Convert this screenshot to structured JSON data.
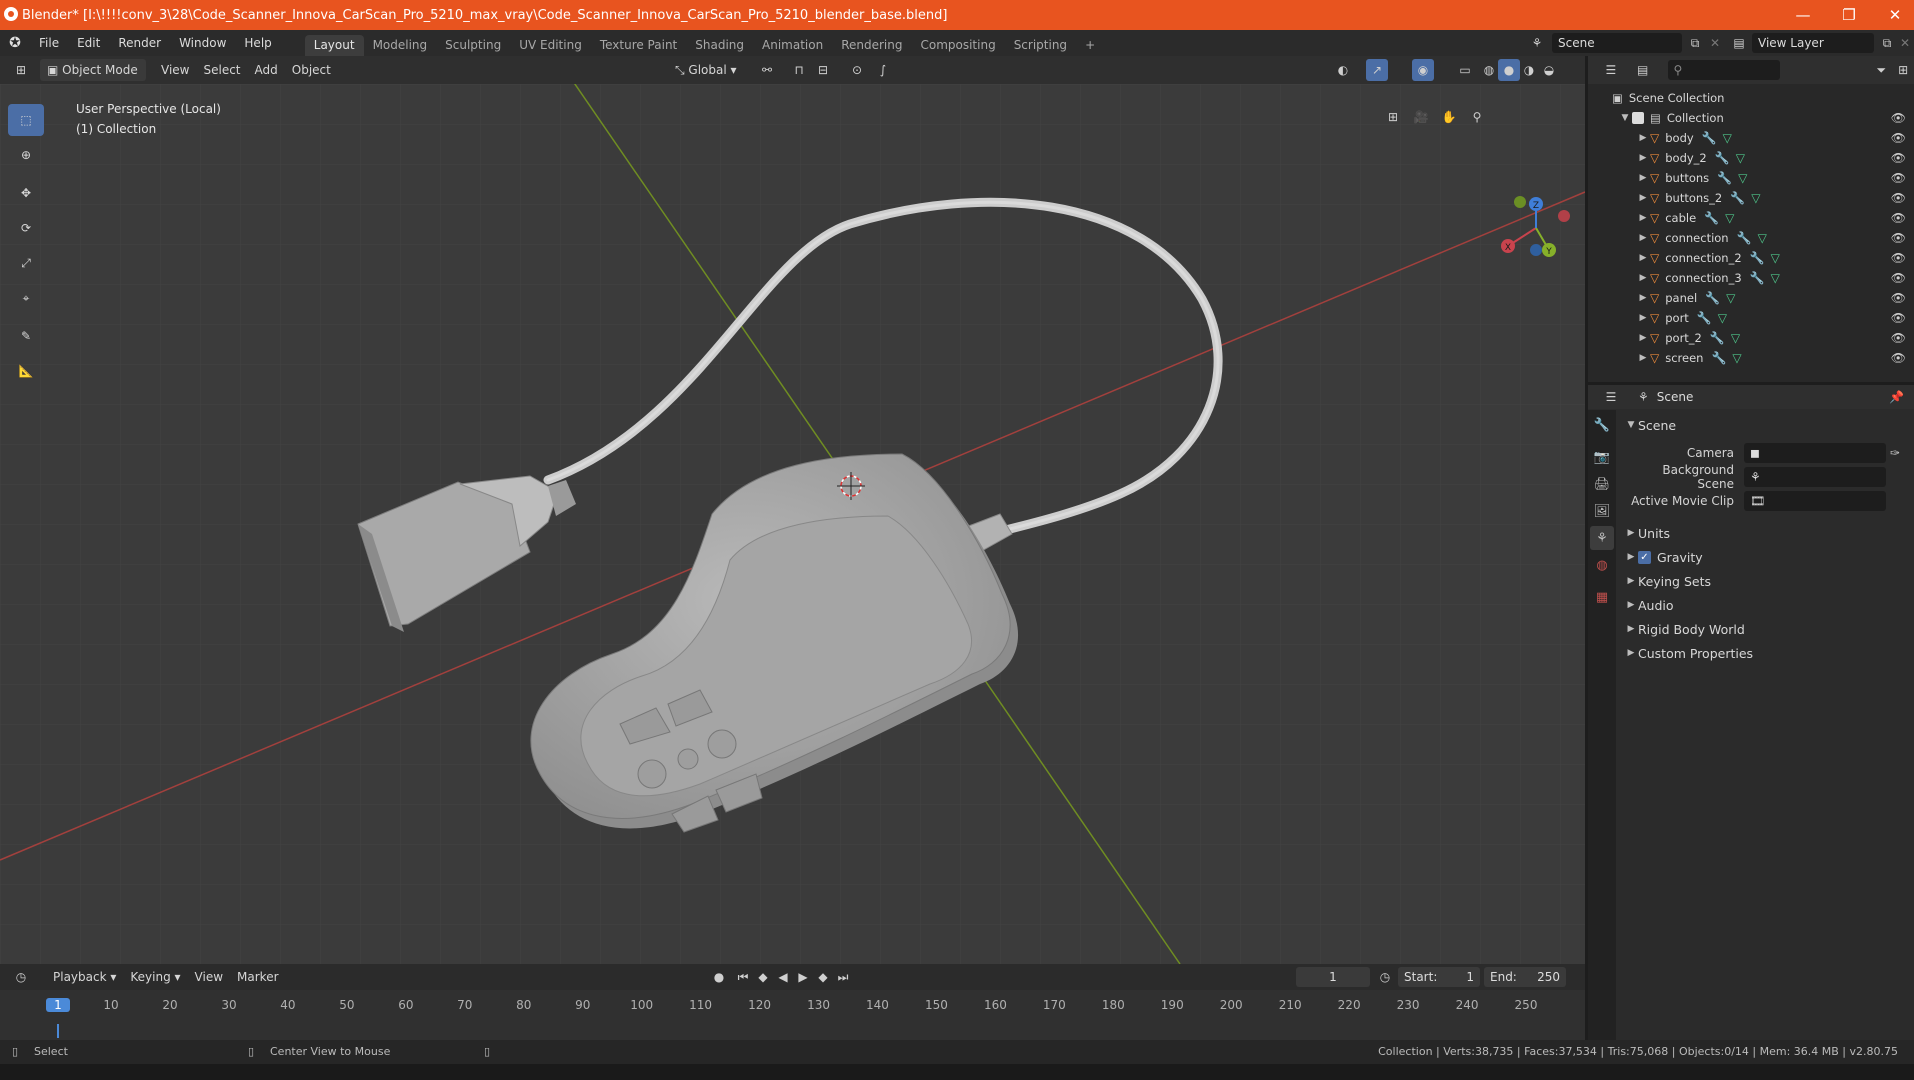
{
  "window": {
    "title": "Blender* [I:\\!!!!conv_3\\28\\Code_Scanner_Innova_CarScan_Pro_5210_max_vray\\Code_Scanner_Innova_CarScan_Pro_5210_blender_base.blend]",
    "minimize": "—",
    "restore": "❐",
    "close": "✕"
  },
  "menu": {
    "items": [
      "File",
      "Edit",
      "Render",
      "Window",
      "Help"
    ],
    "tabs": [
      "Layout",
      "Modeling",
      "Sculpting",
      "UV Editing",
      "Texture Paint",
      "Shading",
      "Animation",
      "Rendering",
      "Compositing",
      "Scripting"
    ],
    "add_tab": "+",
    "scene_label": "Scene",
    "view_layer_label": "View Layer"
  },
  "viewport_header": {
    "mode": "Object Mode",
    "items": [
      "View",
      "Select",
      "Add",
      "Object"
    ],
    "orientation": "Global"
  },
  "viewport": {
    "perspective": "User Perspective (Local)",
    "collection": "(1) Collection",
    "gizmo": {
      "x": "X",
      "y": "Y",
      "z": "Z"
    }
  },
  "outliner": {
    "root": "Scene Collection",
    "collection": "Collection",
    "objects": [
      "body",
      "body_2",
      "buttons",
      "buttons_2",
      "cable",
      "connection",
      "connection_2",
      "connection_3",
      "panel",
      "port",
      "port_2",
      "screen"
    ]
  },
  "properties": {
    "header": "Scene",
    "panel_title": "Scene",
    "camera_label": "Camera",
    "background_label": "Background Scene",
    "movieclip_label": "Active Movie Clip",
    "sections": [
      "Units",
      "Gravity",
      "Keying Sets",
      "Audio",
      "Rigid Body World",
      "Custom Properties"
    ]
  },
  "timeline": {
    "menu": [
      "Playback",
      "Keying",
      "View",
      "Marker"
    ],
    "current_frame": "1",
    "start_label": "Start:",
    "start": "1",
    "end_label": "End:",
    "end": "250",
    "ticks": [
      "1",
      "10",
      "20",
      "30",
      "40",
      "50",
      "60",
      "70",
      "80",
      "90",
      "100",
      "110",
      "120",
      "130",
      "140",
      "150",
      "160",
      "170",
      "180",
      "190",
      "200",
      "210",
      "220",
      "230",
      "240",
      "250"
    ]
  },
  "status": {
    "select": "Select",
    "center": "Center View to Mouse",
    "stats": "Collection | Verts:38,735 | Faces:37,534 | Tris:75,068 | Objects:0/14 | Mem: 36.4 MB | v2.80.75"
  },
  "colors": {
    "titlebar": "#e8541f",
    "accent": "#4b6ea6",
    "x_axis": "#c8434d",
    "y_axis": "#86b02a",
    "z_axis": "#3f7ed8"
  }
}
